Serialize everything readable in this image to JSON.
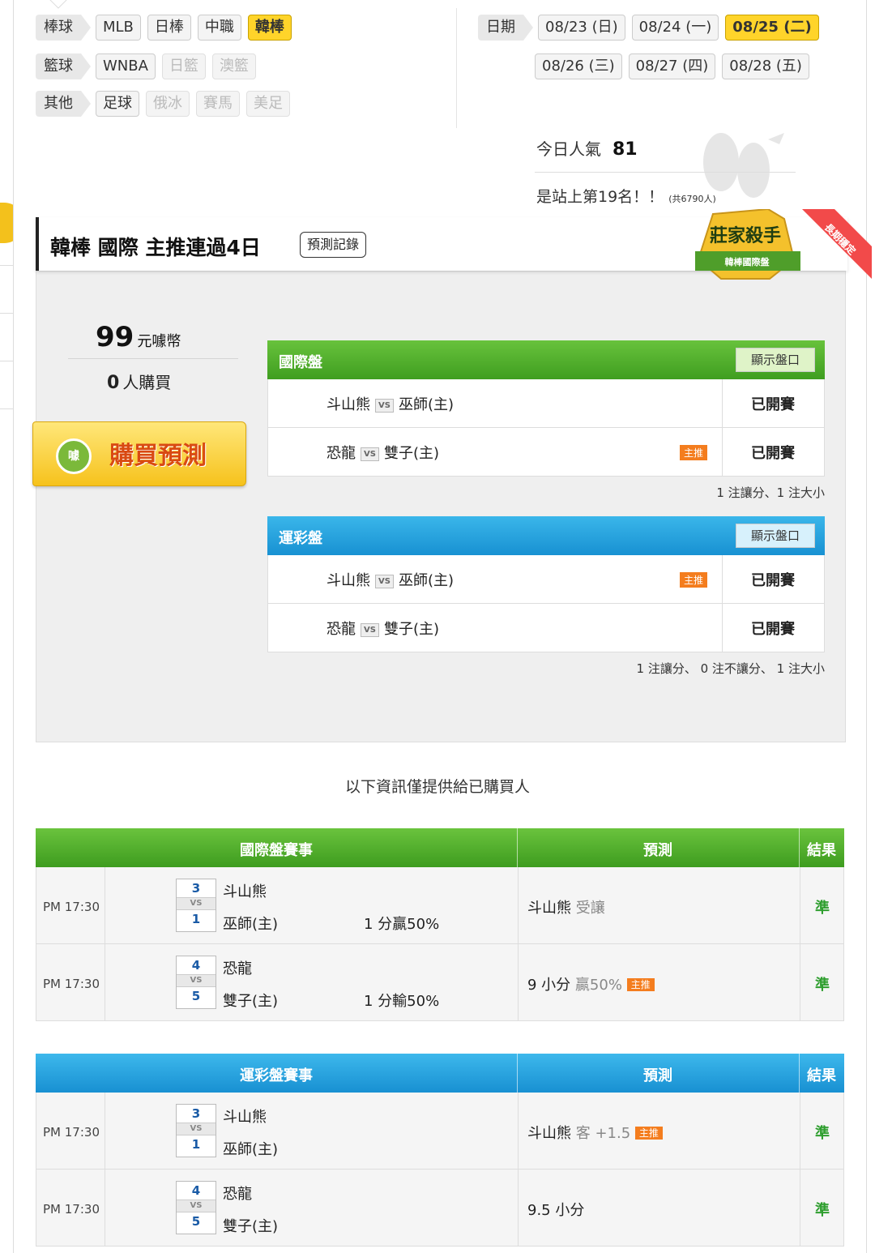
{
  "filters": {
    "rows": [
      {
        "category": "棒球",
        "items": [
          {
            "label": "MLB",
            "state": "normal"
          },
          {
            "label": "日棒",
            "state": "normal"
          },
          {
            "label": "中職",
            "state": "normal"
          },
          {
            "label": "韓棒",
            "state": "active"
          }
        ]
      },
      {
        "category": "籃球",
        "items": [
          {
            "label": "WNBA",
            "state": "normal"
          },
          {
            "label": "日籃",
            "state": "disabled"
          },
          {
            "label": "澳籃",
            "state": "disabled"
          }
        ]
      },
      {
        "category": "其他",
        "items": [
          {
            "label": "足球",
            "state": "normal"
          },
          {
            "label": "俄冰",
            "state": "disabled"
          },
          {
            "label": "賽馬",
            "state": "disabled"
          },
          {
            "label": "美足",
            "state": "disabled"
          }
        ]
      }
    ],
    "date_label": "日期",
    "dates": [
      "08/23 (日)",
      "08/24 (一)",
      "08/25 (二)",
      "08/26 (三)",
      "08/27 (四)",
      "08/28 (五)"
    ],
    "active_date": "08/25 (二)"
  },
  "popularity": {
    "label": "今日人氣",
    "value": "81",
    "rank_text": "是站上第19名！！",
    "total": "(共6790人)"
  },
  "header": {
    "title": "韓棒 國際 主推連過4日",
    "record_button": "預測記錄"
  },
  "badge": {
    "main": "莊家殺手",
    "sub": "韓棒國際盤",
    "ribbon": "長期穩定"
  },
  "purchase": {
    "price": "99",
    "currency": "元噱幣",
    "buyers": "0",
    "buyers_unit": "人購買",
    "buy_label": "購買預測",
    "coin_text": "噱"
  },
  "markets": [
    {
      "name": "國際盤",
      "show_label": "顯示盤口",
      "color": "green",
      "rows": [
        {
          "away": "斗山熊",
          "home": "巫師(主)",
          "main": false,
          "status": "已開賽"
        },
        {
          "away": "恐龍",
          "home": "雙子(主)",
          "main": true,
          "status": "已開賽"
        }
      ],
      "note": "1 注讓分、1 注大小"
    },
    {
      "name": "運彩盤",
      "show_label": "顯示盤口",
      "color": "blue",
      "rows": [
        {
          "away": "斗山熊",
          "home": "巫師(主)",
          "main": true,
          "status": "已開賽"
        },
        {
          "away": "恐龍",
          "home": "雙子(主)",
          "main": false,
          "status": "已開賽"
        }
      ],
      "note": "1 注讓分、 0 注不讓分、 1 注大小"
    }
  ],
  "main_tag": "主推",
  "vs": "VS",
  "info_text": "以下資訊僅提供給已購買人",
  "results": [
    {
      "title": "國際盤賽事",
      "pred_col": "預測",
      "result_col": "結果",
      "color": "green",
      "rows": [
        {
          "time": "PM 17:30",
          "away_score": "3",
          "home_score": "1",
          "away": "斗山熊",
          "home": "巫師(主)",
          "outcome": "1 分贏50%",
          "pred_main": "斗山熊",
          "pred_extra": "受讓",
          "main": false,
          "result": "準"
        },
        {
          "time": "PM 17:30",
          "away_score": "4",
          "home_score": "5",
          "away": "恐龍",
          "home": "雙子(主)",
          "outcome": "1 分輸50%",
          "pred_main": "9 小分",
          "pred_extra": "贏50%",
          "main": true,
          "result": "準"
        }
      ]
    },
    {
      "title": "運彩盤賽事",
      "pred_col": "預測",
      "result_col": "結果",
      "color": "blue",
      "rows": [
        {
          "time": "PM 17:30",
          "away_score": "3",
          "home_score": "1",
          "away": "斗山熊",
          "home": "巫師(主)",
          "outcome": "",
          "pred_main": "斗山熊",
          "pred_extra": "客 +1.5",
          "main": true,
          "result": "準"
        },
        {
          "time": "PM 17:30",
          "away_score": "4",
          "home_score": "5",
          "away": "恐龍",
          "home": "雙子(主)",
          "outcome": "",
          "pred_main": "9.5 小分",
          "pred_extra": "",
          "main": false,
          "result": "準"
        }
      ]
    }
  ]
}
